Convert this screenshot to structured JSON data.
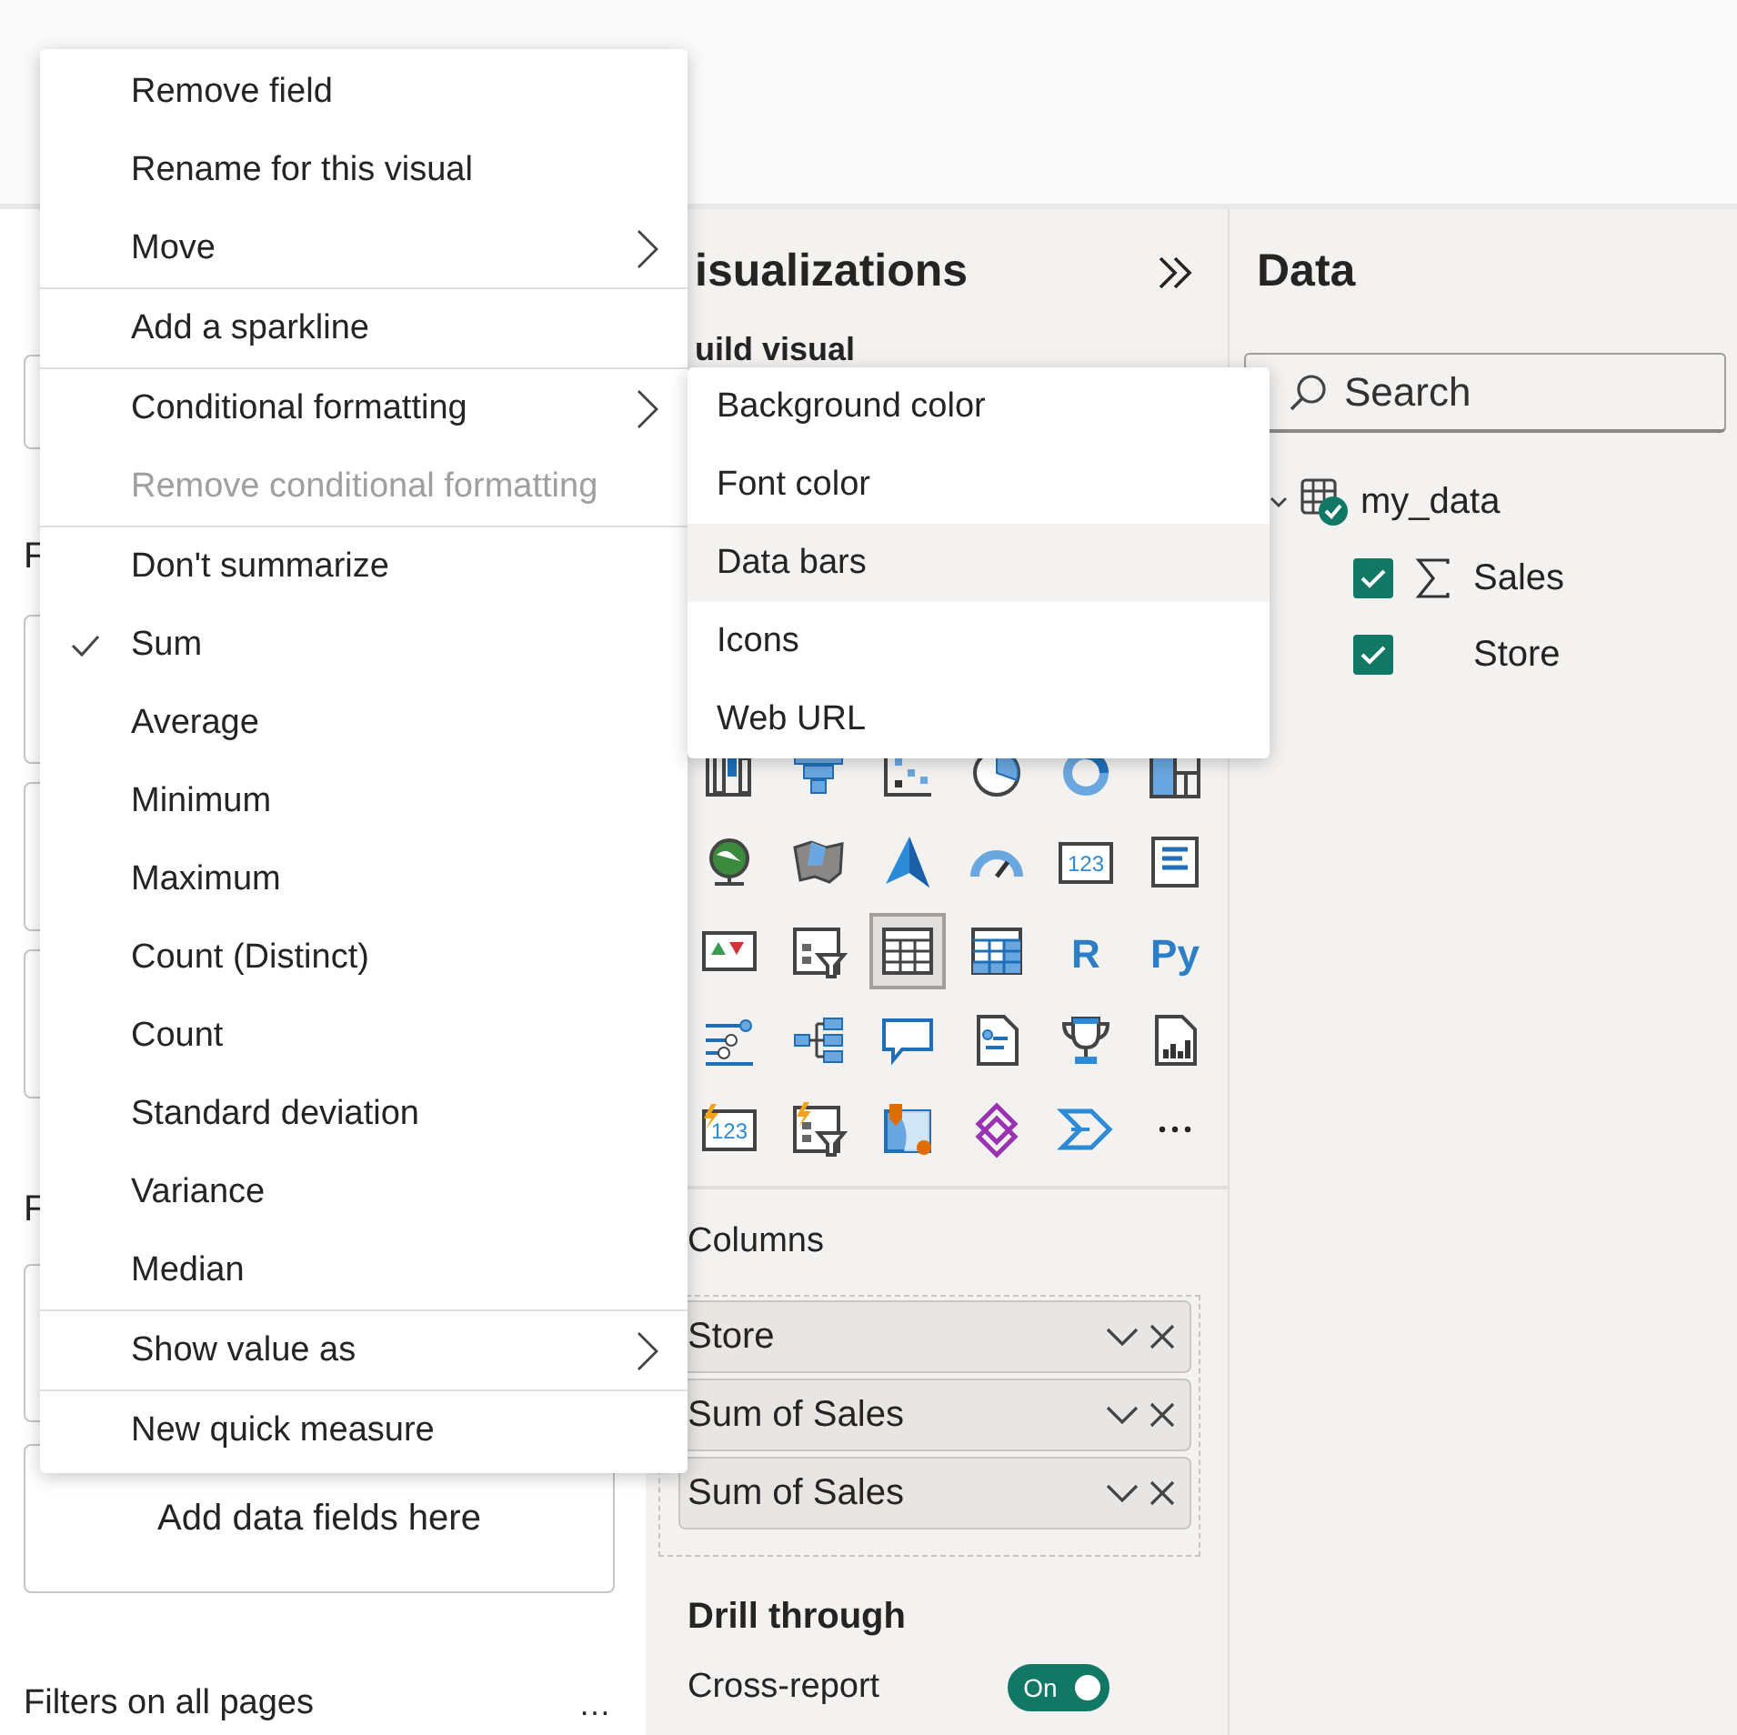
{
  "context_menu": {
    "groups": [
      {
        "items": [
          {
            "label": "Remove field",
            "submenu": false,
            "disabled": false,
            "checked": false
          },
          {
            "label": "Rename for this visual",
            "submenu": false,
            "disabled": false,
            "checked": false
          },
          {
            "label": "Move",
            "submenu": true,
            "disabled": false,
            "checked": false
          }
        ]
      },
      {
        "items": [
          {
            "label": "Add a sparkline",
            "submenu": false,
            "disabled": false,
            "checked": false
          }
        ]
      },
      {
        "items": [
          {
            "label": "Conditional formatting",
            "submenu": true,
            "disabled": false,
            "checked": false
          },
          {
            "label": "Remove conditional formatting",
            "submenu": false,
            "disabled": true,
            "checked": false
          }
        ]
      },
      {
        "items": [
          {
            "label": "Don't summarize",
            "submenu": false,
            "disabled": false,
            "checked": false
          },
          {
            "label": "Sum",
            "submenu": false,
            "disabled": false,
            "checked": true
          },
          {
            "label": "Average",
            "submenu": false,
            "disabled": false,
            "checked": false
          },
          {
            "label": "Minimum",
            "submenu": false,
            "disabled": false,
            "checked": false
          },
          {
            "label": "Maximum",
            "submenu": false,
            "disabled": false,
            "checked": false
          },
          {
            "label": "Count (Distinct)",
            "submenu": false,
            "disabled": false,
            "checked": false
          },
          {
            "label": "Count",
            "submenu": false,
            "disabled": false,
            "checked": false
          },
          {
            "label": "Standard deviation",
            "submenu": false,
            "disabled": false,
            "checked": false
          },
          {
            "label": "Variance",
            "submenu": false,
            "disabled": false,
            "checked": false
          },
          {
            "label": "Median",
            "submenu": false,
            "disabled": false,
            "checked": false
          }
        ]
      },
      {
        "items": [
          {
            "label": "Show value as",
            "submenu": true,
            "disabled": false,
            "checked": false
          }
        ]
      },
      {
        "items": [
          {
            "label": "New quick measure",
            "submenu": false,
            "disabled": false,
            "checked": false
          }
        ]
      }
    ]
  },
  "submenu": {
    "items": [
      {
        "label": "Background color",
        "highlighted": false
      },
      {
        "label": "Font color",
        "highlighted": false
      },
      {
        "label": "Data bars",
        "highlighted": true
      },
      {
        "label": "Icons",
        "highlighted": false
      },
      {
        "label": "Web URL",
        "highlighted": false
      }
    ]
  },
  "filters_pane": {
    "section_headings": [
      "F",
      "F"
    ],
    "drop_zone_text": "Add data fields here",
    "all_pages_label": "Filters on all pages",
    "more_label": "…"
  },
  "visualizations_pane": {
    "title": "isualizations",
    "subtitle": "uild visual",
    "visual_types": [
      {
        "kind": "column",
        "selected": false
      },
      {
        "kind": "funnel",
        "selected": false
      },
      {
        "kind": "scatter",
        "selected": false
      },
      {
        "kind": "pie",
        "selected": false
      },
      {
        "kind": "donut",
        "selected": false
      },
      {
        "kind": "treemap",
        "selected": false
      },
      {
        "kind": "globe",
        "selected": false
      },
      {
        "kind": "filled-map",
        "selected": false
      },
      {
        "kind": "azure-map",
        "selected": false
      },
      {
        "kind": "gauge",
        "selected": false
      },
      {
        "kind": "card",
        "label": "123",
        "selected": false
      },
      {
        "kind": "multi-row-card",
        "selected": false
      },
      {
        "kind": "kpi",
        "selected": false
      },
      {
        "kind": "slicer",
        "selected": false
      },
      {
        "kind": "table",
        "selected": true
      },
      {
        "kind": "matrix",
        "selected": false
      },
      {
        "kind": "r",
        "label": "R",
        "selected": false
      },
      {
        "kind": "python",
        "label": "Py",
        "selected": false
      },
      {
        "kind": "key-influencers",
        "selected": false
      },
      {
        "kind": "decomposition",
        "selected": false
      },
      {
        "kind": "qa",
        "selected": false
      },
      {
        "kind": "narrative",
        "selected": false
      },
      {
        "kind": "trophy",
        "selected": false
      },
      {
        "kind": "paginated",
        "selected": false
      },
      {
        "kind": "new-card",
        "label": "123",
        "selected": false
      },
      {
        "kind": "new-slicer",
        "selected": false
      },
      {
        "kind": "arcgis",
        "selected": false
      },
      {
        "kind": "power-apps",
        "selected": false
      },
      {
        "kind": "power-automate",
        "selected": false
      },
      {
        "kind": "more",
        "selected": false
      }
    ],
    "columns_label": "Columns",
    "column_fields": [
      {
        "label": "Store"
      },
      {
        "label": "Sum of Sales"
      },
      {
        "label": "Sum of Sales"
      }
    ],
    "drill_through_label": "Drill through",
    "cross_report": {
      "label": "Cross-report",
      "on": true,
      "state_text": "On"
    }
  },
  "data_pane": {
    "title": "Data",
    "search": {
      "placeholder": "Search"
    },
    "tables": [
      {
        "name": "my_data",
        "expanded": true,
        "in_use": true,
        "fields": [
          {
            "name": "Sales",
            "kind": "numeric",
            "checked": true
          },
          {
            "name": "Store",
            "kind": "text",
            "checked": true
          }
        ]
      }
    ]
  }
}
